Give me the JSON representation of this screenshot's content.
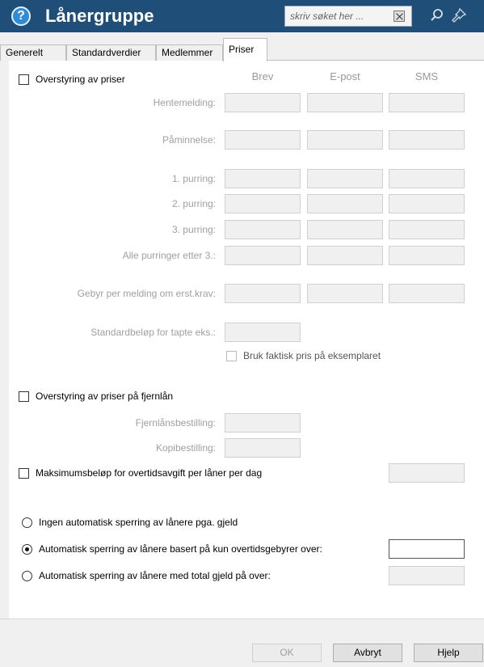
{
  "window": {
    "title": "Lånergruppe",
    "search_placeholder": "skriv søket her ..."
  },
  "tabs": [
    "Generelt",
    "Standardverdier",
    "Medlemmer",
    "Priser"
  ],
  "prices": {
    "override_label": "Overstyring av priser",
    "columns": [
      "Brev",
      "E-post",
      "SMS"
    ],
    "rows": [
      "Hentemelding:",
      "Påminnelse:",
      "1. purring:",
      "2. purring:",
      "3. purring:",
      "Alle purringer etter 3.:",
      "Gebyr per melding om erst.krav:"
    ],
    "standard_amount_label": "Standardbeløp for tapte eks.:",
    "actual_price_label": "Bruk faktisk pris på eksemplaret"
  },
  "ill": {
    "override_label": "Overstyring av priser på fjernlån",
    "ill_order_label": "Fjernlånsbestilling:",
    "copy_order_label": "Kopibestilling:"
  },
  "max_fee_label": "Maksimumsbeløp for overtidsavgift per låner per dag",
  "blocking": {
    "options": [
      "Ingen automatisk sperring av lånere pga. gjeld",
      "Automatisk sperring av lånere basert på kun overtidsgebyrer over:",
      "Automatisk sperring av lånere med total gjeld på over:"
    ],
    "selected_index": 1
  },
  "footer": {
    "ok": "OK",
    "cancel": "Avbryt",
    "help": "Hjelp"
  }
}
